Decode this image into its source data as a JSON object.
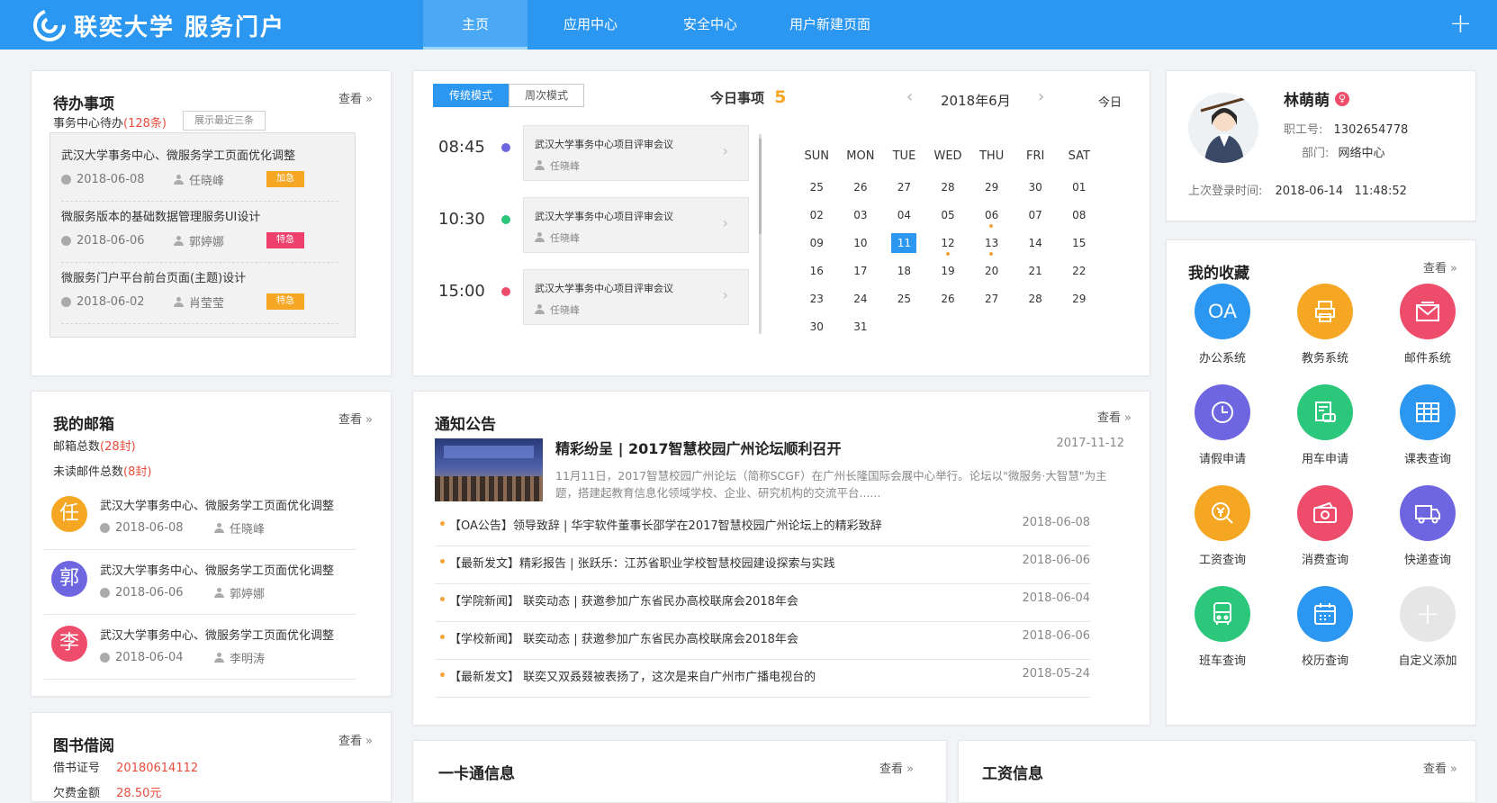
{
  "header": {
    "logo_text": "联奕大学 服务门户",
    "nav": [
      "主页",
      "应用中心",
      "安全中心",
      "用户新建页面"
    ],
    "active_nav": 0,
    "plus": "+"
  },
  "todo": {
    "title": "待办事项",
    "more": "查看",
    "center_label": "事务中心待办",
    "center_count": "(128条)",
    "hint": "展示最近三条",
    "items": [
      {
        "title": "武汉大学事务中心、微服务学工页面优化调整",
        "date": "2018-06-08",
        "person": "任晓峰",
        "tag": "加急",
        "tag_color": "#f5a623"
      },
      {
        "title": "微服务版本的基础数据管理服务UI设计",
        "date": "2018-06-06",
        "person": "郭婷娜",
        "tag": "特急",
        "tag_color": "#ee3f6d"
      },
      {
        "title": "微服务门户平台前台页面(主题)设计",
        "date": "2018-06-02",
        "person": "肖莹莹",
        "tag": "特急",
        "tag_color": "#f5a623"
      }
    ]
  },
  "schedule": {
    "mode_traditional": "传统模式",
    "mode_weekly": "周次模式",
    "today_label": "今日事项",
    "today_count": "5",
    "month_label": "2018年6月",
    "today_btn": "今日",
    "events": [
      {
        "time": "08:45",
        "dot": "#6e66e0",
        "title": "武汉大学事务中心项目评审会议",
        "person": "任晓峰"
      },
      {
        "time": "10:30",
        "dot": "#2bc77b",
        "title": "武汉大学事务中心项目评审会议",
        "person": "任晓峰"
      },
      {
        "time": "15:00",
        "dot": "#ee4c6b",
        "title": "武汉大学事务中心项目评审会议",
        "person": "任晓峰"
      }
    ],
    "weekdays": [
      "SUN",
      "MON",
      "TUE",
      "WED",
      "THU",
      "FRI",
      "SAT"
    ],
    "weeks": [
      [
        "25",
        "26",
        "27",
        "28",
        "29",
        "30",
        "01"
      ],
      [
        "02",
        "03",
        "04",
        "05",
        "06",
        "07",
        "08"
      ],
      [
        "09",
        "10",
        "11",
        "12",
        "13",
        "14",
        "15"
      ],
      [
        "16",
        "17",
        "18",
        "19",
        "20",
        "21",
        "22"
      ],
      [
        "23",
        "24",
        "25",
        "26",
        "27",
        "28",
        "29"
      ],
      [
        "30",
        "31",
        "",
        "",
        "",
        "",
        ""
      ]
    ],
    "today": "11",
    "event_days": [
      "06",
      "12",
      "13"
    ]
  },
  "profile": {
    "name": "林萌萌",
    "emp_label": "职工号:",
    "emp_no": "1302654778",
    "dept_label": "部门:",
    "dept": "网络中心",
    "login_label": "上次登录时间:",
    "login_time": "2018-06-14   11:48:52"
  },
  "favorites": {
    "title": "我的收藏",
    "more": "查看",
    "items": [
      {
        "label": "办公系统",
        "color": "#2b97f0",
        "icon": "OA"
      },
      {
        "label": "教务系统",
        "color": "#f5a623",
        "icon": "printer-icon"
      },
      {
        "label": "邮件系统",
        "color": "#ee4c6b",
        "icon": "mail-icon"
      },
      {
        "label": "请假申请",
        "color": "#6e66e0",
        "icon": "clock-icon"
      },
      {
        "label": "用车申请",
        "color": "#2bc77b",
        "icon": "car-icon"
      },
      {
        "label": "课表查询",
        "color": "#2b97f0",
        "icon": "table-icon"
      },
      {
        "label": "工资查询",
        "color": "#f5a623",
        "icon": "yen-icon"
      },
      {
        "label": "消费查询",
        "color": "#ee4c6b",
        "icon": "wallet-icon"
      },
      {
        "label": "快递查询",
        "color": "#6e66e0",
        "icon": "truck-icon"
      },
      {
        "label": "班车查询",
        "color": "#2bc77b",
        "icon": "bus-icon"
      },
      {
        "label": "校历查询",
        "color": "#2b97f0",
        "icon": "calendar-icon"
      },
      {
        "label": "自定义添加",
        "color": "#e6e6e6",
        "icon": "+"
      }
    ]
  },
  "mail": {
    "title": "我的邮箱",
    "more": "查看",
    "total_label": "邮箱总数",
    "total": "(28封)",
    "unread_label": "未读邮件总数",
    "unread": "(8封)",
    "items": [
      {
        "avatar": "任",
        "color": "#f5a623",
        "title": "武汉大学事务中心、微服务学工页面优化调整",
        "date": "2018-06-08",
        "person": "任晓峰"
      },
      {
        "avatar": "郭",
        "color": "#6e66e0",
        "title": "武汉大学事务中心、微服务学工页面优化调整",
        "date": "2018-06-06",
        "person": "郭婷娜"
      },
      {
        "avatar": "李",
        "color": "#ee4c6b",
        "title": "武汉大学事务中心、微服务学工页面优化调整",
        "date": "2018-06-04",
        "person": "李明涛"
      }
    ]
  },
  "notice": {
    "title": "通知公告",
    "more": "查看",
    "headline": "精彩纷呈 | 2017智慧校园广州论坛顺利召开",
    "headline_date": "2017-11-12",
    "summary": "11月11日，2017智慧校园广州论坛（简称SCGF）在广州长隆国际会展中心举行。论坛以\"微服务·大智慧\"为主题，搭建起教育信息化领域学校、企业、研究机构的交流平台......",
    "items": [
      {
        "title": "【OA公告】领导致辞 | 华宇软件董事长邵学在2017智慧校园广州论坛上的精彩致辞",
        "date": "2018-06-08"
      },
      {
        "title": "【最新发文】精彩报告 | 张跃乐：江苏省职业学校智慧校园建设探索与实践",
        "date": "2018-06-06"
      },
      {
        "title": "【学院新闻】 联奕动态 | 获邀参加广东省民办高校联席会2018年会",
        "date": "2018-06-04"
      },
      {
        "title": "【学校新闻】  联奕动态 | 获邀参加广东省民办高校联席会2018年会",
        "date": "2018-06-06"
      },
      {
        "title": "【最新发文】  联奕又双叒叕被表扬了，这次是来自广州市广播电视台的",
        "date": "2018-05-24"
      }
    ]
  },
  "library": {
    "title": "图书借阅",
    "more": "查看",
    "card_label": "借书证号",
    "card_no": "20180614112",
    "fee_label": "欠费金额",
    "fee": "28.50元"
  },
  "ecard": {
    "title": "一卡通信息",
    "more": "查看"
  },
  "salary": {
    "title": "工资信息",
    "more": "查看"
  }
}
